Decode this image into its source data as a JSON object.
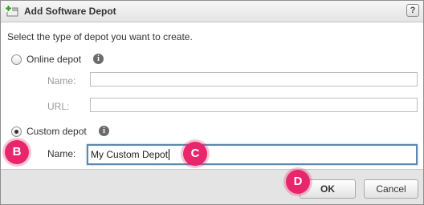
{
  "dialog": {
    "title": "Add Software Depot",
    "help_label": "?"
  },
  "body": {
    "prompt": "Select the type of depot you want to create.",
    "online": {
      "label": "Online depot",
      "selected": false,
      "name_label": "Name:",
      "name_value": "",
      "url_label": "URL:",
      "url_value": ""
    },
    "custom": {
      "label": "Custom depot",
      "selected": true,
      "name_label": "Name:",
      "name_value": "My Custom Depot"
    },
    "info_glyph": "i"
  },
  "footer": {
    "ok_label": "OK",
    "cancel_label": "Cancel"
  },
  "markers": [
    "B",
    "C",
    "D"
  ],
  "colors": {
    "marker": "#e8266b",
    "focus_border": "#5b88ad",
    "title_icon_green": "#3a9a2c"
  },
  "icons": {
    "title": "add-depot-icon",
    "help": "help-icon",
    "info": "info-icon"
  }
}
